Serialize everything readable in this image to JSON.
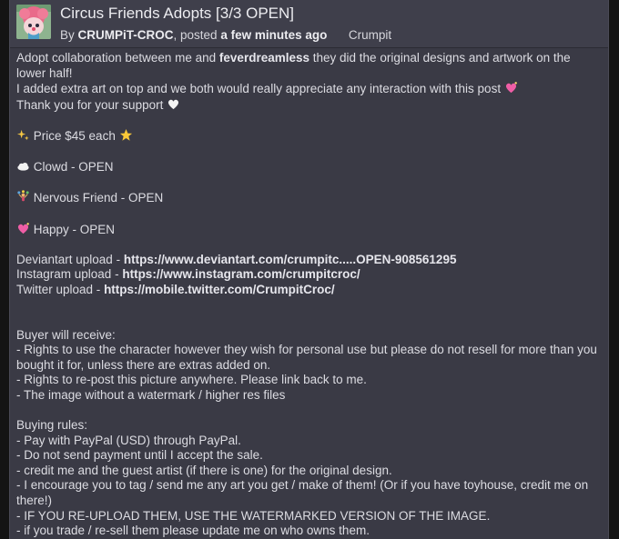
{
  "post": {
    "title": "Circus Friends Adopts [3/3 OPEN]",
    "by_prefix": "By",
    "author": "CRUMPiT-CROC",
    "posted_prefix": ", posted",
    "time": "a few minutes ago",
    "collection": "Crumpit"
  },
  "body": {
    "intro_a": "Adopt collaboration between me and",
    "collaborator": "feverdreamless",
    "intro_b": "they did the original designs and artwork on the lower half!",
    "line2": "I added extra art on top and we both would really appreciate any interaction with this post",
    "line3": "Thank you for your support",
    "price": "Price $45 each",
    "items": [
      "Clowd - OPEN",
      "Nervous Friend - OPEN",
      "Happy - OPEN"
    ],
    "uploads": [
      {
        "label": "Deviantart upload -",
        "url": "https://www.deviantart.com/crumpitc.....OPEN-908561295"
      },
      {
        "label": "Instagram upload -",
        "url": "https://www.instagram.com/crumpitcroc/"
      },
      {
        "label": "Twitter upload -",
        "url": "https://mobile.twitter.com/CrumpitCroc/"
      }
    ],
    "buyer_heading": "Buyer will receive:",
    "buyer_items": [
      "- Rights to use the character however they wish for personal use but please do not resell for more than you bought it for, unless there are extras added on.",
      "- Rights to re-post this picture anywhere. Please link back to me.",
      "- The image without a watermark / higher res files"
    ],
    "rules_heading": "Buying rules:",
    "rules": [
      "- Pay with PayPal (USD) through PayPal.",
      "- Do not send payment until I accept the sale.",
      "- credit me and the guest artist (if there is one) for the original design.",
      "- I encourage you to tag / send me any art you get / make of them! (Or if you have toyhouse, credit me on there!)",
      "- IF YOU RE-UPLOAD THEM, USE THE WATERMARKED VERSION OF THE IMAGE.",
      "- if you trade / re-sell them please update me on who owns them."
    ]
  },
  "icons": {
    "avatar": "clown-avatar-image",
    "heart_pink": "sparkling-heart-icon",
    "heart_white": "white-heart-icon",
    "sparkles": "sparkles-icon",
    "star": "glowing-star-icon",
    "cloud": "cloud-icon",
    "juggling": "juggling-person-icon"
  },
  "colors": {
    "panel": "#3a3a45",
    "header": "#3f3f4b",
    "text": "#dcdce2",
    "background": "#141414"
  }
}
